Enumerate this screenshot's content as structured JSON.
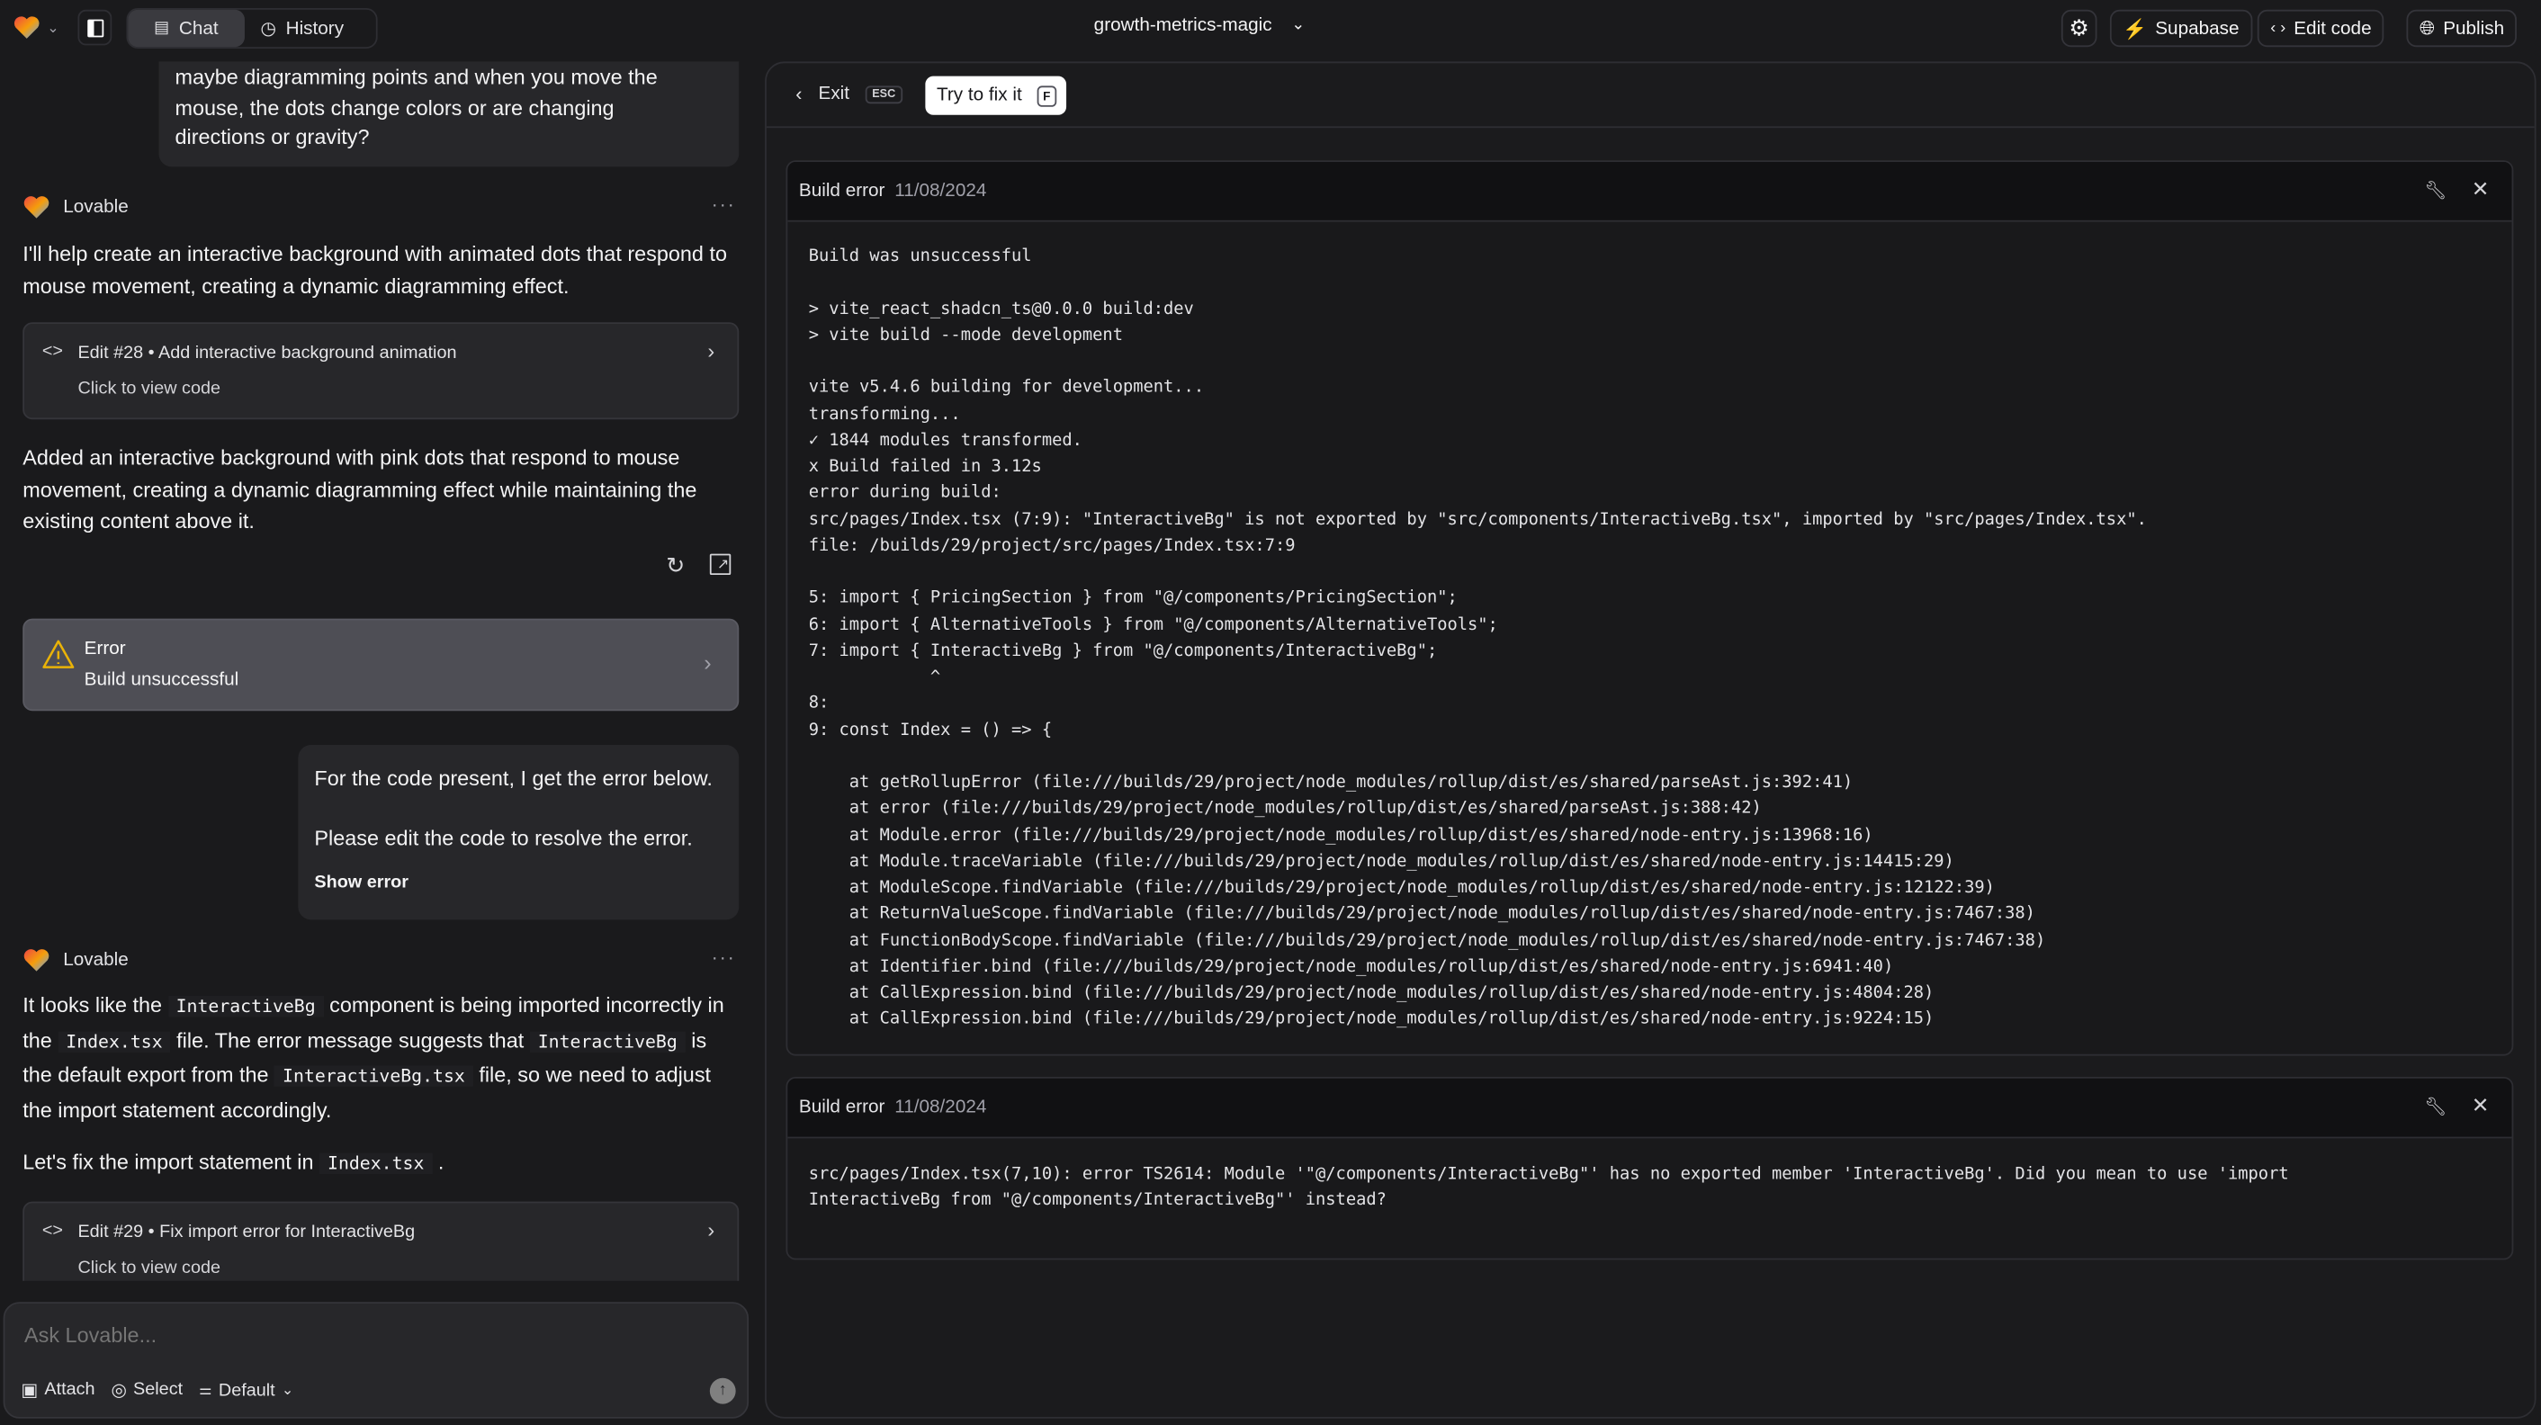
{
  "topbar": {
    "chat_tab": "Chat",
    "history_tab": "History",
    "project_name": "growth-metrics-magic",
    "supabase": "Supabase",
    "edit_code": "Edit code",
    "publish": "Publish",
    "accent_supabase": "#3ecf8e"
  },
  "chat": {
    "msg1_lines": [
      "maybe diagramming points and when you move the",
      "mouse, the dots change colors or are changing",
      "directions or gravity?"
    ],
    "author": "Lovable",
    "reply1": "I'll help create an interactive background with animated dots that respond to mouse movement, creating a dynamic diagramming effect.",
    "edit1": {
      "title": "Edit #28 • Add interactive background animation",
      "subtitle": "Click to view code"
    },
    "reply1b": "Added an interactive background with pink dots that respond to mouse movement, creating a dynamic diagramming effect while maintaining the existing content above it.",
    "error_card": {
      "title": "Error",
      "subtitle": "Build unsuccessful",
      "icon_color": "#eab308"
    },
    "msg2": {
      "line1": "For the code present, I get the error below.",
      "line2": "Please edit the code to resolve the error.",
      "show_error": "Show error"
    },
    "reply2_segments": [
      {
        "text": "It looks like the ",
        "code": false
      },
      {
        "text": "InteractiveBg",
        "code": true
      },
      {
        "text": " component is being imported incorrectly in the ",
        "code": false
      },
      {
        "text": "Index.tsx",
        "code": true
      },
      {
        "text": " file. The error message suggests that ",
        "code": false
      },
      {
        "text": "InteractiveBg",
        "code": true
      },
      {
        "text": " is the default export from the ",
        "code": false
      },
      {
        "text": "InteractiveBg.tsx",
        "code": true
      },
      {
        "text": " file, so we need to adjust the import statement accordingly.",
        "code": false
      }
    ],
    "reply3_segments": [
      {
        "text": "Let's fix the import statement in ",
        "code": false
      },
      {
        "text": "Index.tsx",
        "code": true
      },
      {
        "text": " .",
        "code": false
      }
    ],
    "edit2": {
      "title": "Edit #29 • Fix import error for InteractiveBg",
      "subtitle": "Click to view code"
    },
    "input_placeholder": "Ask Lovable...",
    "attach": "Attach",
    "select": "Select",
    "default": "Default"
  },
  "panel": {
    "exit": "Exit",
    "exit_key": "ESC",
    "fix": "Try to fix it",
    "fix_key": "F",
    "errors": [
      {
        "title": "Build error",
        "date": "11/08/2024",
        "lines": [
          "Build was unsuccessful",
          "",
          "> vite_react_shadcn_ts@0.0.0 build:dev",
          "> vite build --mode development",
          "",
          "vite v5.4.6 building for development...",
          "transforming...",
          "✓ 1844 modules transformed.",
          "x Build failed in 3.12s",
          "error during build:",
          "src/pages/Index.tsx (7:9): \"InteractiveBg\" is not exported by \"src/components/InteractiveBg.tsx\", imported by \"src/pages/Index.tsx\".",
          "file: /builds/29/project/src/pages/Index.tsx:7:9",
          "",
          "5: import { PricingSection } from \"@/components/PricingSection\";",
          "6: import { AlternativeTools } from \"@/components/AlternativeTools\";",
          "7: import { InteractiveBg } from \"@/components/InteractiveBg\";",
          "            ^",
          "8: ",
          "9: const Index = () => {",
          "",
          "    at getRollupError (file:///builds/29/project/node_modules/rollup/dist/es/shared/parseAst.js:392:41)",
          "    at error (file:///builds/29/project/node_modules/rollup/dist/es/shared/parseAst.js:388:42)",
          "    at Module.error (file:///builds/29/project/node_modules/rollup/dist/es/shared/node-entry.js:13968:16)",
          "    at Module.traceVariable (file:///builds/29/project/node_modules/rollup/dist/es/shared/node-entry.js:14415:29)",
          "    at ModuleScope.findVariable (file:///builds/29/project/node_modules/rollup/dist/es/shared/node-entry.js:12122:39)",
          "    at ReturnValueScope.findVariable (file:///builds/29/project/node_modules/rollup/dist/es/shared/node-entry.js:7467:38)",
          "    at FunctionBodyScope.findVariable (file:///builds/29/project/node_modules/rollup/dist/es/shared/node-entry.js:7467:38)",
          "    at Identifier.bind (file:///builds/29/project/node_modules/rollup/dist/es/shared/node-entry.js:6941:40)",
          "    at CallExpression.bind (file:///builds/29/project/node_modules/rollup/dist/es/shared/node-entry.js:4804:28)",
          "    at CallExpression.bind (file:///builds/29/project/node_modules/rollup/dist/es/shared/node-entry.js:9224:15)"
        ]
      },
      {
        "title": "Build error",
        "date": "11/08/2024",
        "lines": [
          "src/pages/Index.tsx(7,10): error TS2614: Module '\"@/components/InteractiveBg\"' has no exported member 'InteractiveBg'. Did you mean to use 'import",
          "InteractiveBg from \"@/components/InteractiveBg\"' instead?"
        ]
      }
    ]
  }
}
